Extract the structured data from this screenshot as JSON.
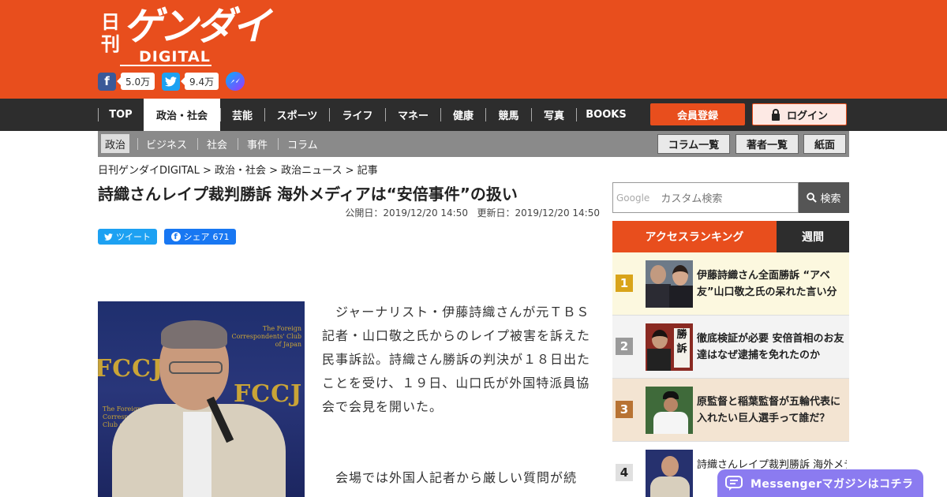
{
  "header": {
    "logo_vertical": "日刊",
    "logo_main": "ゲンダイ",
    "logo_sub": "DIGITAL",
    "facebook_count": "5.0万",
    "twitter_count": "9.4万",
    "colors": {
      "brand": "#e84e1d",
      "nav": "#2d2d2d"
    }
  },
  "nav": {
    "items": [
      "TOP",
      "政治・社会",
      "芸能",
      "スポーツ",
      "ライフ",
      "マネー",
      "健康",
      "競馬",
      "写真",
      "BOOKS"
    ],
    "active": "政治・社会",
    "register": "会員登録",
    "login": "ログイン"
  },
  "subnav": {
    "items": [
      "政治",
      "ビジネス",
      "社会",
      "事件",
      "コラム"
    ],
    "buttons": [
      "コラム一覧",
      "著者一覧",
      "紙面"
    ]
  },
  "breadcrumb": "日刊ゲンダイDIGITAL > 政治・社会 > 政治ニュース > 記事",
  "article": {
    "title": "詩織さんレイプ裁判勝訴 海外メディアは“安倍事件”の扱い",
    "published": "公開日：2019/12/20 14:50",
    "updated": "更新日：2019/12/20 14:50",
    "tweet_label": "ツイート",
    "share_label": "シェア",
    "share_count": "671",
    "photo_text": {
      "fccj": "FCCJ",
      "club": "The Foreign Correspondents' Club of Japan"
    },
    "paragraphs": [
      "　ジャーナリスト・伊藤詩織さんが元ＴＢＳ記者・山口敬之氏からのレイプ被害を訴えた民事訴訟。詩織さん勝訴の判決が１８日出たことを受け、１９日、山口氏が外国特派員協会で会見を開いた。",
      "　会場では外国人記者から厳しい質問が続"
    ]
  },
  "search": {
    "google": "Google",
    "placeholder": "カスタム検索",
    "button": "検索"
  },
  "ranking": {
    "tab_access": "アクセスランキング",
    "tab_weekly": "週間",
    "items": [
      {
        "rank": "1",
        "title": "伊藤詩織さん全面勝訴 “アベ友”山口敬之氏の呆れた言い分"
      },
      {
        "rank": "2",
        "title": "徹底検証が必要 安倍首相のお友達はなぜ逮捕を免れたのか"
      },
      {
        "rank": "3",
        "title": "原監督と稲葉監督が五輪代表に入れたい巨人選手って誰だ？"
      },
      {
        "rank": "4",
        "title": "詩織さんレイプ裁判勝訴 海外メディ"
      }
    ]
  },
  "messenger": {
    "label": "Messengerマガジンはコチラ"
  }
}
